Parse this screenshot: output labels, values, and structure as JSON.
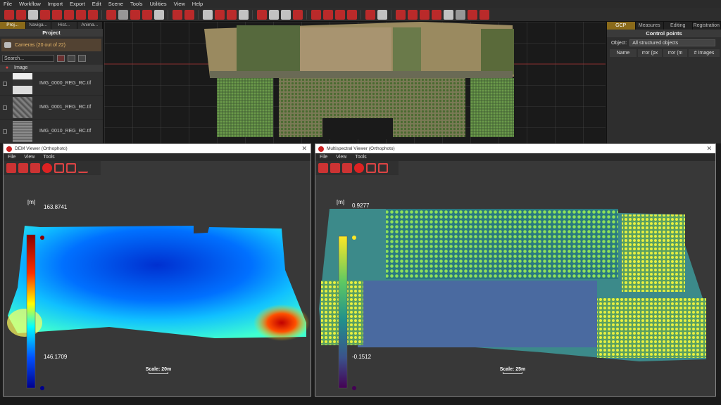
{
  "menu": [
    "File",
    "Workflow",
    "Import",
    "Export",
    "Edit",
    "Scene",
    "Tools",
    "Utilities",
    "View",
    "Help"
  ],
  "left": {
    "tabs": [
      "Proj...",
      "Naviga...",
      "Hist...",
      "Anima..."
    ],
    "title": "Project",
    "cameras": "Cameras (20 out of 22)",
    "search": "Search...",
    "col_image": "Image",
    "rows": [
      {
        "name": "IMG_0000_REG_RC.tif"
      },
      {
        "name": "IMG_0001_REG_RC.tif"
      },
      {
        "name": "IMG_0010_REG_RC.tif"
      }
    ]
  },
  "right": {
    "tabs": [
      "GCP",
      "Measures",
      "Editing",
      "Registration"
    ],
    "title": "Control points",
    "object_label": "Object:",
    "object_value": "All structured objects",
    "cols": [
      "Name",
      "rror (px",
      "rror (m",
      "# Images"
    ]
  },
  "dem": {
    "title": "DEM Viewer (Orthophoto)",
    "menu": [
      "File",
      "View",
      "Tools"
    ],
    "unit": "[m]",
    "max": "163.8741",
    "min": "146.1709",
    "scale": "Scale: 20m"
  },
  "ms": {
    "title": "Multispectral Viewer (Orthophoto)",
    "menu": [
      "File",
      "View",
      "Tools"
    ],
    "unit": "[m]",
    "max": "0.9277",
    "min": "-0.1512",
    "scale": "Scale: 25m"
  },
  "colors": {
    "accent": "#8a6a1a",
    "tool_red": "#d42a2a"
  }
}
